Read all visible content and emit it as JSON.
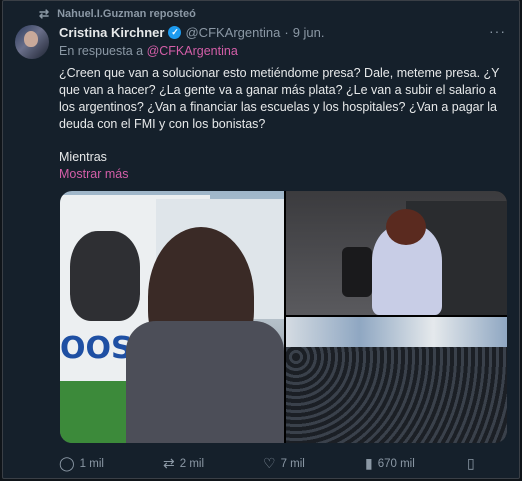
{
  "repost": {
    "label": "Nahuel.I.Guzman reposteó"
  },
  "author": {
    "name": "Cristina Kirchner",
    "handle": "@CFKArgentina",
    "dot": "·",
    "date": "9 jun."
  },
  "reply": {
    "prefix": "En respuesta a",
    "mention": "@CFKArgentina"
  },
  "tweet": {
    "text": "¿Creen que van a solucionar esto metiéndome presa? Dale, meteme presa. ¿Y que van a hacer? ¿La gente va a ganar más plata? ¿Le van a subir el salario a los argentinos? ¿Van a financiar las escuelas y los hospitales? ¿Van a pagar la deuda con el FMI y con los bonistas?",
    "continuation": "Mientras",
    "show_more": "Mostrar más"
  },
  "media": {
    "img1": {
      "banner_text": "OOS"
    }
  },
  "actions": {
    "replies": "1 mil",
    "reposts": "2 mil",
    "likes": "7 mil",
    "views": "670 mil"
  },
  "colors": {
    "accent_link": "#d35ea8",
    "verified": "#1d9bf0",
    "background": "#15202b"
  }
}
